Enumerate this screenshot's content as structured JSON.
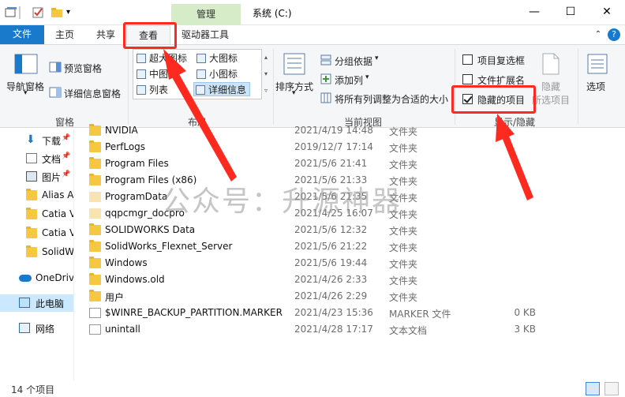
{
  "titlebar": {
    "context_tab": "管理",
    "title": "系统 (C:)",
    "minimize": "—",
    "maximize": "☐",
    "close": "✕"
  },
  "tabs": {
    "file": "文件",
    "home": "主页",
    "share": "共享",
    "view": "查看",
    "drive_tools": "驱动器工具"
  },
  "ribbon": {
    "panes": {
      "nav_pane": "导航窗格",
      "preview_pane": "预览窗格",
      "details_pane": "详细信息窗格",
      "group_label": "窗格"
    },
    "layout": {
      "items": [
        "超大图标",
        "大图标",
        "中图标",
        "小图标",
        "列表",
        "详细信息"
      ],
      "group_label": "布局"
    },
    "current_view": {
      "sort_by": "排序方式",
      "group_by": "分组依据",
      "add_column": "添加列",
      "fit_columns": "将所有列调整为合适的大小",
      "group_label": "当前视图"
    },
    "show_hide": {
      "item_checkboxes": "项目复选框",
      "file_extensions": "文件扩展名",
      "hidden_items": "隐藏的项目",
      "hide_selected_line1": "隐藏",
      "hide_selected_line2": "所选项目",
      "group_label": "显示/隐藏",
      "item_checkboxes_checked": false,
      "file_extensions_checked": false,
      "hidden_items_checked": true
    },
    "options": "选项"
  },
  "sidebar": {
    "items": [
      {
        "label": "下载",
        "icon": "download-icon",
        "pinned": true
      },
      {
        "label": "文档",
        "icon": "document-icon",
        "pinned": true
      },
      {
        "label": "图片",
        "icon": "picture-icon",
        "pinned": true
      },
      {
        "label": "Alias A",
        "icon": "folder-icon"
      },
      {
        "label": "Catia V",
        "icon": "folder-icon"
      },
      {
        "label": "Catia V",
        "icon": "folder-icon"
      },
      {
        "label": "SolidW",
        "icon": "folder-icon"
      },
      {
        "label": "OneDriv",
        "icon": "cloud-icon"
      },
      {
        "label": "此电脑",
        "icon": "computer-icon"
      },
      {
        "label": "网络",
        "icon": "network-icon"
      }
    ]
  },
  "files": [
    {
      "name": "NVIDIA",
      "date": "2021/4/19 14:48",
      "type": "文件夹",
      "size": "",
      "kind": "folder"
    },
    {
      "name": "PerfLogs",
      "date": "2019/12/7 17:14",
      "type": "文件夹",
      "size": "",
      "kind": "folder"
    },
    {
      "name": "Program Files",
      "date": "2021/5/6 21:41",
      "type": "文件夹",
      "size": "",
      "kind": "folder"
    },
    {
      "name": "Program Files (x86)",
      "date": "2021/5/6 21:33",
      "type": "文件夹",
      "size": "",
      "kind": "folder"
    },
    {
      "name": "ProgramData",
      "date": "2021/5/6 21:35",
      "type": "文件夹",
      "size": "",
      "kind": "folder-hidden"
    },
    {
      "name": "qqpcmgr_docpro",
      "date": "2021/4/25 16:07",
      "type": "文件夹",
      "size": "",
      "kind": "folder-hidden"
    },
    {
      "name": "SOLIDWORKS Data",
      "date": "2021/5/6 12:32",
      "type": "文件夹",
      "size": "",
      "kind": "folder"
    },
    {
      "name": "SolidWorks_Flexnet_Server",
      "date": "2021/5/6 21:22",
      "type": "文件夹",
      "size": "",
      "kind": "folder"
    },
    {
      "name": "Windows",
      "date": "2021/5/6 19:44",
      "type": "文件夹",
      "size": "",
      "kind": "folder"
    },
    {
      "name": "Windows.old",
      "date": "2021/4/26 2:33",
      "type": "文件夹",
      "size": "",
      "kind": "folder"
    },
    {
      "name": "用户",
      "date": "2021/4/26 2:29",
      "type": "文件夹",
      "size": "",
      "kind": "folder"
    },
    {
      "name": "$WINRE_BACKUP_PARTITION.MARKER",
      "date": "2021/4/23 15:36",
      "type": "MARKER 文件",
      "size": "0 KB",
      "kind": "file"
    },
    {
      "name": "unintall",
      "date": "2021/4/28 17:17",
      "type": "文本文档",
      "size": "3 KB",
      "kind": "file"
    }
  ],
  "status": {
    "count": "14 个项目"
  },
  "watermark": "公众号：升源神器",
  "colors": {
    "accent": "#1979ca",
    "annotation": "#ff2a1f",
    "context_tab": "#d6ecc8"
  }
}
